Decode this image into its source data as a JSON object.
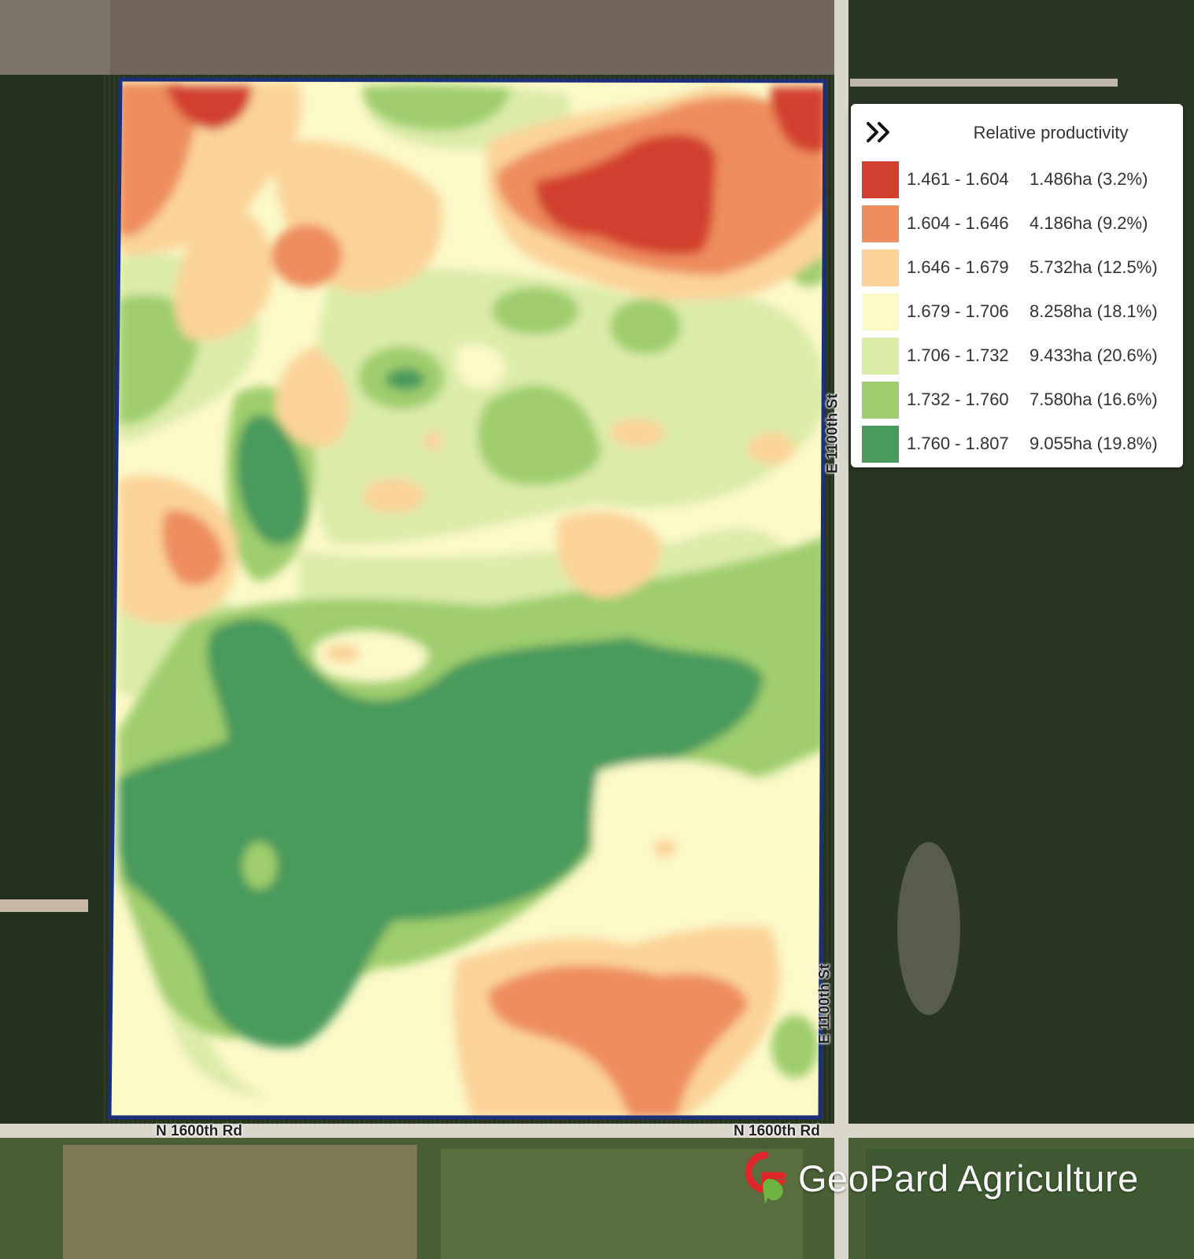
{
  "legend": {
    "title": "Relative productivity",
    "toggle_icon": "double-chevron-right-icon",
    "classes": [
      {
        "range": "1.461 - 1.604",
        "area": "1.486ha (3.2%)",
        "color": "#d13f2f"
      },
      {
        "range": "1.604 - 1.646",
        "area": "4.186ha (9.2%)",
        "color": "#ee8d5d"
      },
      {
        "range": "1.646 - 1.679",
        "area": "5.732ha (12.5%)",
        "color": "#fbd39a"
      },
      {
        "range": "1.679 - 1.706",
        "area": "8.258ha (18.1%)",
        "color": "#fbf9c8"
      },
      {
        "range": "1.706 - 1.732",
        "area": "9.433ha (20.6%)",
        "color": "#dbeba8"
      },
      {
        "range": "1.732 - 1.760",
        "area": "7.580ha (16.6%)",
        "color": "#9fcd6d"
      },
      {
        "range": "1.760 - 1.807",
        "area": "9.055ha (19.8%)",
        "color": "#4a9a5d"
      }
    ]
  },
  "roads": {
    "south_left": "N 1600th Rd",
    "south_right": "N 1600th Rd",
    "east_top": "E 1100th St",
    "east_bottom": "E 1100th St"
  },
  "brand": {
    "name": "GeoPard Agriculture",
    "logo_icon": "geopard-logo-icon"
  },
  "field": {
    "border_color": "#1b2f7a"
  }
}
